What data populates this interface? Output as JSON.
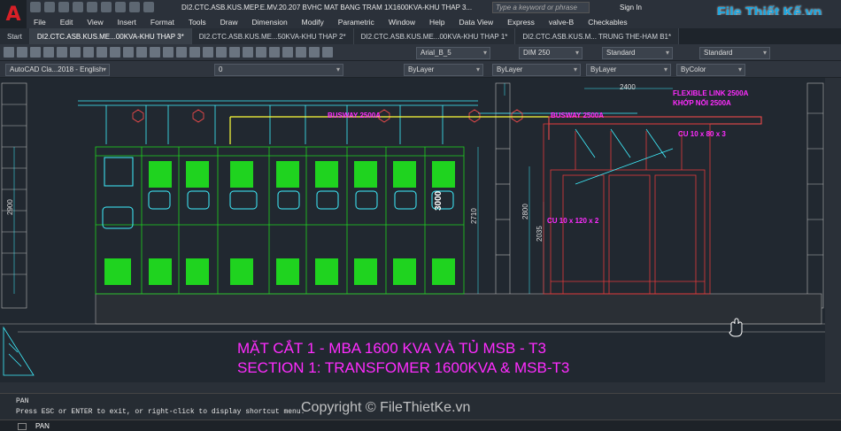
{
  "app": {
    "logo_letter": "A",
    "title": "DI2.CTC.ASB.KUS.MEP.E.MV.20.207 BVHC MAT BANG TRAM 1X1600KVA-KHU THAP 3...",
    "search_placeholder": "Type a keyword or phrase",
    "sign_in": "Sign In",
    "brand": "File Thiết Kế.vn"
  },
  "menu": [
    "File",
    "Edit",
    "View",
    "Insert",
    "Format",
    "Tools",
    "Draw",
    "Dimension",
    "Modify",
    "Parametric",
    "Window",
    "Help",
    "Data View",
    "Express",
    "valve-B",
    "Checkables"
  ],
  "tabs": [
    {
      "label": "Start"
    },
    {
      "label": "DI2.CTC.ASB.KUS.ME...00KVA-KHU THAP 3*"
    },
    {
      "label": "DI2.CTC.ASB.KUS.ME...50KVA-KHU THAP 2*"
    },
    {
      "label": "DI2.CTC.ASB.KUS.ME...00KVA-KHU THAP 1*"
    },
    {
      "label": "DI2.CTC.ASB.KUS.M... TRUNG THE-HAM B1*"
    }
  ],
  "toolbar": {
    "text_style": "Arial_B_5",
    "dim_style": "DIM 250",
    "table_style": "Standard",
    "multileader_style": "Standard",
    "workspace": "AutoCAD Cla...2018 - English",
    "layer": "0",
    "color": "ByLayer",
    "linetype": "ByLayer",
    "lineweight": "ByLayer",
    "plotstyle": "ByColor"
  },
  "drawing": {
    "busway_left": "BUSWAY 2500A",
    "busway_right": "BUSWAY 2500A",
    "flexible_link": "FLEXIBLE LINK 2500A",
    "khop_noi": "KHỚP NỐI 2500A",
    "cu_top": "CU 10 x 80 x 3",
    "cu_side": "CU 10 x 120 x 2",
    "dim_2900": "2900",
    "dim_2710": "2710",
    "dim_2800": "2800",
    "dim_2035": "2035",
    "dim_2400": "2400",
    "dim_3000": "3000",
    "title_vi": "MẶT CẮT 1 - MBA 1600 KVA VÀ TỦ MSB - T3",
    "title_en": "SECTION 1: TRANSFOMER 1600KVA & MSB-T3"
  },
  "command": {
    "history_1": "PAN",
    "history_2": "Press ESC or ENTER to exit, or right-click to display shortcut menu.",
    "prompt": "PAN"
  },
  "watermark": "Copyright © FileThietKe.vn",
  "colors": {
    "canvas": "#212830",
    "panel_green": "#1fd31f",
    "magenta": "#ff2cff",
    "cyan": "#3ff0ff",
    "red": "#e23a3a",
    "yellow": "#ffff3a"
  }
}
